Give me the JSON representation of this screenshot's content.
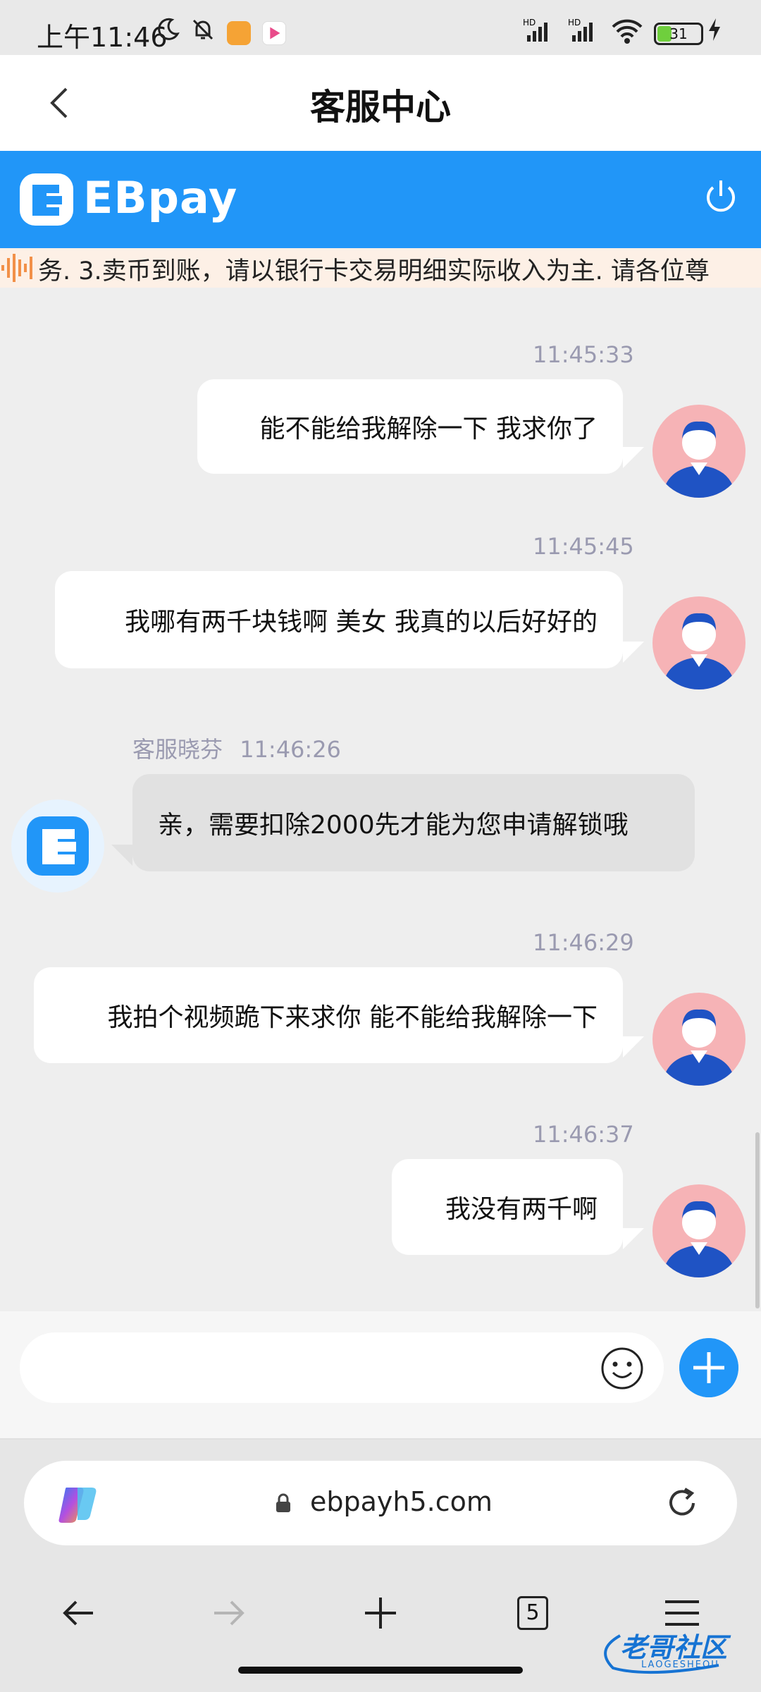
{
  "status_bar": {
    "time": "上午11:46",
    "battery": "31",
    "signal_labels": [
      "HD",
      "HD"
    ]
  },
  "header": {
    "title": "客服中心"
  },
  "brand": {
    "name": "EBpay",
    "accent_color": "#2196f8"
  },
  "marquee": {
    "text": "务. 3.卖币到账，请以银行卡交易明细实际收入为主. 请各位尊"
  },
  "messages": [
    {
      "side": "user",
      "time": "11:45:33",
      "text": "能不能给我解除一下 我求你了"
    },
    {
      "side": "user",
      "time": "11:45:45",
      "text": "我哪有两千块钱啊 美女 我真的以后好好的"
    },
    {
      "side": "agent",
      "sender": "客服晓芬",
      "time": "11:46:26",
      "text": "亲，需要扣除2000先才能为您申请解锁哦"
    },
    {
      "side": "user",
      "time": "11:46:29",
      "text": "我拍个视频跪下来求你 能不能给我解除一下"
    },
    {
      "side": "user",
      "time": "11:46:37",
      "text": "我没有两千啊"
    }
  ],
  "composer": {
    "value": "",
    "placeholder": ""
  },
  "browser": {
    "url": "ebpayh5.com",
    "tab_count": "5"
  },
  "watermark": {
    "text": "老哥社区",
    "sub": "LAOGESHEQU"
  }
}
